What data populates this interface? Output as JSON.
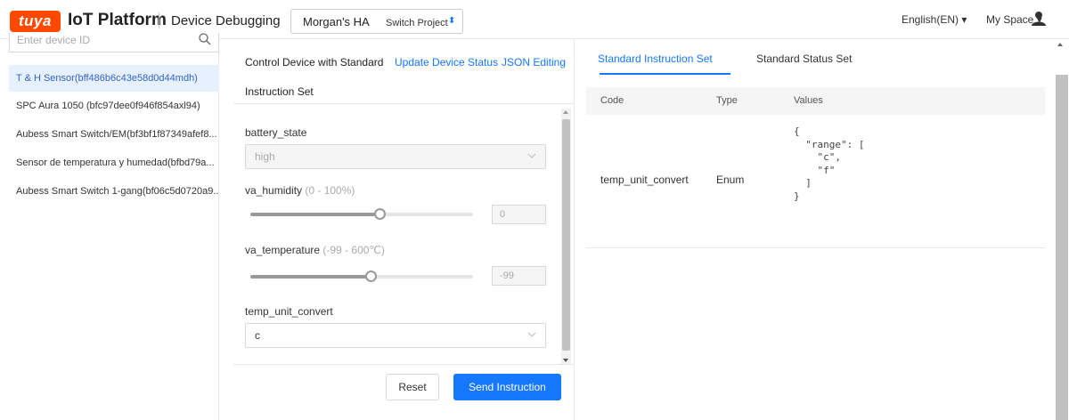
{
  "header": {
    "logo_text": "tuya",
    "brand": "IoT Platform",
    "page_title": "Device Debugging",
    "project_name": "Morgan's HA",
    "project_type": "Switch Project",
    "language": "English(EN) ▾",
    "space": "My Space ▾"
  },
  "sidebar": {
    "search_placeholder": "Enter device ID",
    "devices": [
      {
        "label": "T & H Sensor(bff486b6c43e58d0d44mdh)",
        "active": true
      },
      {
        "label": "SPC Aura 1050 (bfc97dee0f946f854axl94)",
        "active": false
      },
      {
        "label": "Aubess Smart Switch/EM(bf3bf1f87349afef8...",
        "active": false
      },
      {
        "label": "Sensor de temperatura y humedad(bfbd79a...",
        "active": false
      },
      {
        "label": "Aubess Smart Switch 1-gang(bf06c5d0720a9...",
        "active": false
      }
    ]
  },
  "control": {
    "tab_standard_line1": "Control Device with Standard",
    "tab_standard_line2": "Instruction Set",
    "tab_update": "Update Device Status",
    "tab_json": "JSON Editing",
    "fields": {
      "battery_state": {
        "label": "battery_state",
        "value": "high"
      },
      "va_humidity": {
        "label": "va_humidity",
        "hint": "(0 - 100%)",
        "value": "0",
        "level": 0.58
      },
      "va_temperature": {
        "label": "va_temperature",
        "hint": "(-99 - 600℃)",
        "value": "-99",
        "level": 0.54
      },
      "temp_unit_convert": {
        "label": "temp_unit_convert",
        "value": "c"
      }
    },
    "reset_label": "Reset",
    "send_label": "Send Instruction"
  },
  "standard": {
    "tab_instruction": "Standard Instruction Set",
    "tab_status": "Standard Status Set",
    "columns": {
      "code": "Code",
      "type": "Type",
      "values": "Values"
    },
    "rows": [
      {
        "code": "temp_unit_convert",
        "type": "Enum",
        "values": "{\n  \"range\": [\n    \"c\",\n    \"f\"\n  ]\n}"
      }
    ]
  },
  "colors": {
    "brand": "#ff4800",
    "accent": "#1677ff",
    "active_bg": "#e6f0ff"
  }
}
